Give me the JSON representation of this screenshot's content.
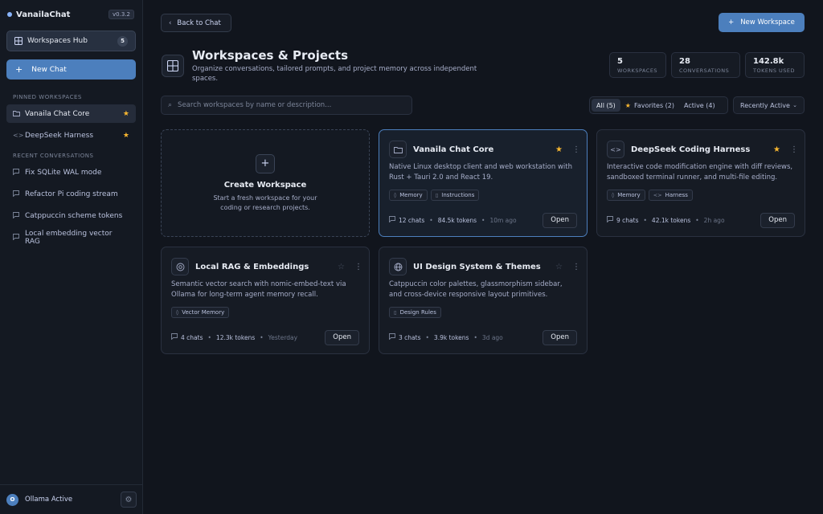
{
  "sidebar": {
    "brand": "VanailaChat",
    "version": "v0.3.2",
    "hub_label": "Workspaces Hub",
    "hub_count": "5",
    "new_chat_label": "New Chat",
    "pinned_heading": "PINNED WORKSPACES",
    "pinned": [
      {
        "label": "Vanaila Chat Core",
        "icon": "folder-icon"
      },
      {
        "label": "DeepSeek Harness",
        "icon": "code-icon"
      }
    ],
    "recent_heading": "RECENT CONVERSATIONS",
    "recent": [
      {
        "label": "Fix SQLite WAL mode"
      },
      {
        "label": "Refactor Pi coding stream"
      },
      {
        "label": "Catppuccin scheme tokens"
      },
      {
        "label": "Local embedding vector RAG"
      }
    ],
    "avatar_initial": "O",
    "status": "Ollama Active"
  },
  "header": {
    "back_label": "Back to Chat",
    "new_workspace_label": "New Workspace",
    "title": "Workspaces & Projects",
    "subtitle": "Organize conversations, tailored prompts, and project memory across independent spaces.",
    "stats": [
      {
        "value": "5",
        "label": "WORKSPACES"
      },
      {
        "value": "28",
        "label": "CONVERSATIONS"
      },
      {
        "value": "142.8k",
        "label": "TOKENS USED"
      }
    ]
  },
  "toolbar": {
    "search_placeholder": "Search workspaces by name or description...",
    "filters": [
      {
        "label": "All (5)"
      },
      {
        "label": "Favorites (2)"
      },
      {
        "label": "Active (4)"
      }
    ],
    "sort_label": "Recently Active"
  },
  "create_card": {
    "title": "Create Workspace",
    "description": "Start a fresh workspace for your coding or research projects."
  },
  "workspaces": [
    {
      "name": "Vanaila Chat Core",
      "description": "Native Linux desktop client and web workstation with Rust + Tauri 2.0 and React 19.",
      "tags": [
        "Memory",
        "Instructions"
      ],
      "chats": "12 chats",
      "tokens": "84.5k tokens",
      "time": "10m ago",
      "favorite": true,
      "icon": "folder-icon",
      "open_label": "Open"
    },
    {
      "name": "DeepSeek Coding Harness",
      "description": "Interactive code modification engine with diff reviews, sandboxed terminal runner, and multi-file editing.",
      "tags": [
        "Memory",
        "Harness"
      ],
      "chats": "9 chats",
      "tokens": "42.1k tokens",
      "time": "2h ago",
      "favorite": true,
      "icon": "code-icon",
      "open_label": "Open"
    },
    {
      "name": "Local RAG & Embeddings",
      "description": "Semantic vector search with nomic-embed-text via Ollama for long-term agent memory recall.",
      "tags": [
        "Vector Memory"
      ],
      "chats": "4 chats",
      "tokens": "12.3k tokens",
      "time": "Yesterday",
      "favorite": false,
      "icon": "target-icon",
      "open_label": "Open"
    },
    {
      "name": "UI Design System & Themes",
      "description": "Catppuccin color palettes, glassmorphism sidebar, and cross-device responsive layout primitives.",
      "tags": [
        "Design Rules"
      ],
      "chats": "3 chats",
      "tokens": "3.9k tokens",
      "time": "3d ago",
      "favorite": false,
      "icon": "globe-icon",
      "open_label": "Open"
    }
  ]
}
